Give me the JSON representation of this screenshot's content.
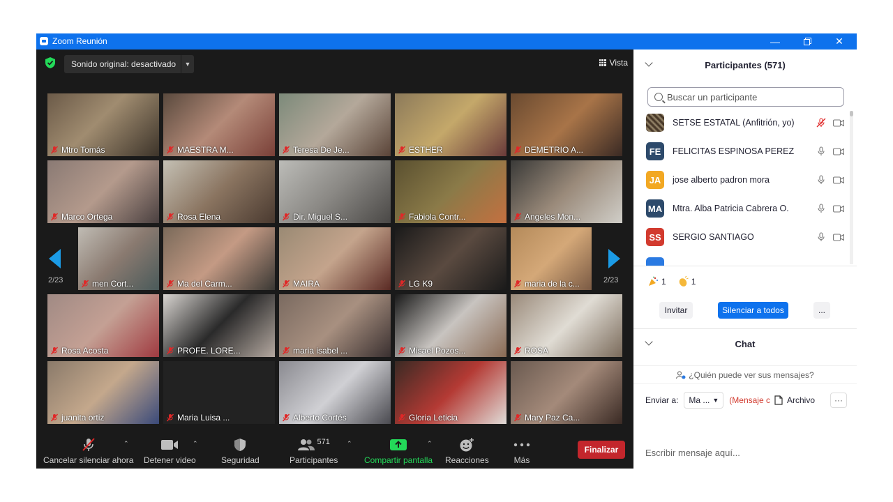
{
  "window": {
    "title": "Zoom Reunión"
  },
  "video": {
    "sound_button": "Sonido original: desactivado",
    "view_button": "Vista",
    "page_left": "2/23",
    "page_right": "2/23",
    "tiles": [
      {
        "name": "Mtro Tomás",
        "bg": "linear-gradient(135deg,#6b5a48,#a08c70 45%,#3d342a)"
      },
      {
        "name": "MAESTRA M...",
        "bg": "linear-gradient(135deg,#5a4a3e,#b48a78 50%,#7a4038)"
      },
      {
        "name": "Teresa De Je...",
        "bg": "linear-gradient(135deg,#7c8a7a,#b4a89a 50%,#5a4438)"
      },
      {
        "name": "ESTHER",
        "bg": "linear-gradient(135deg,#8c7a5a,#c4a86a 50%,#6a3a3a)"
      },
      {
        "name": "DEMETRIO A...",
        "bg": "linear-gradient(135deg,#6a4a30,#a87448 50%,#3a2a24)"
      },
      {
        "name": "Marco Ortega",
        "bg": "linear-gradient(135deg,#8a7a74,#b49a8c 50%,#4a4040)"
      },
      {
        "name": "Rosa Elena",
        "bg": "linear-gradient(135deg,#c4c0b4,#8a7460 50%,#4a3a30)"
      },
      {
        "name": "Dir. Miguel S...",
        "bg": "linear-gradient(135deg,#bcbcb8,#8a8884 50%,#4a4846)"
      },
      {
        "name": "Fabiola Contr...",
        "bg": "linear-gradient(135deg,#5a5030,#8a7a48 50%,#c47040)"
      },
      {
        "name": "Angeles Mon...",
        "bg": "linear-gradient(135deg,#3a3a38,#9a8a7a 50%,#d0cec8)"
      },
      {
        "name": "men Cort...",
        "bg": "linear-gradient(135deg,#c0bcb4,#8a7a70 50%,#4a5a5a)"
      },
      {
        "name": "Ma del Carm...",
        "bg": "linear-gradient(135deg,#7a6a5a,#c49a84 50%,#3a3834)"
      },
      {
        "name": "MAIRA",
        "bg": "linear-gradient(135deg,#9a8a74,#c4a48c 50%,#5a2a24)"
      },
      {
        "name": "LG K9",
        "bg": "linear-gradient(135deg,#1a1a1a,#5a4a40 50%,#1a1a1a)"
      },
      {
        "name": "maria de la c...",
        "bg": "linear-gradient(135deg,#b48a5a,#d4a878 50%,#7a5a44)"
      },
      {
        "name": "Rosa Acosta",
        "bg": "linear-gradient(135deg,#a08a84,#c4a094 50%,#a03a40)"
      },
      {
        "name": "PROFE. LORE...",
        "bg": "linear-gradient(135deg,#d8d4d0,#2a2a2a 50%,#b4a8a0)"
      },
      {
        "name": "maria isabel ...",
        "bg": "linear-gradient(135deg,#7a6a60,#a89080 50%,#3a3030)"
      },
      {
        "name": "Misael Pozos...",
        "bg": "linear-gradient(135deg,#1a1a1a,#c8c4c0 50%,#8a6a54)"
      },
      {
        "name": "ROSA",
        "bg": "linear-gradient(135deg,#9a8a7a,#e0dcd4 50%,#7a6a5a)"
      },
      {
        "name": "juanita ortiz",
        "bg": "linear-gradient(135deg,#8a7a6a,#c4a88c 50%,#3a4a7a)"
      },
      {
        "name": "Maria Luisa ...",
        "bg": "#222222"
      },
      {
        "name": "Alberto Cortés",
        "bg": "linear-gradient(135deg,#8a8a90,#d0d0d4 50%,#4a4a50)"
      },
      {
        "name": "Gloria Leticia",
        "bg": "linear-gradient(135deg,#3a2a24,#b43a34 50%,#e0dcd8)"
      },
      {
        "name": "Mary Paz Ca...",
        "bg": "linear-gradient(135deg,#6a5a50,#a48a7a 50%,#3a2a24)"
      }
    ]
  },
  "toolbar": {
    "mute": "Cancelar silenciar ahora",
    "video": "Detener video",
    "security": "Seguridad",
    "participants": "Participantes",
    "participants_count": "571",
    "share": "Compartir pantalla",
    "reactions": "Reacciones",
    "more": "Más",
    "end": "Finalizar"
  },
  "panel": {
    "participants_title": "Participantes (571)",
    "search_placeholder": "Buscar un participante",
    "participants": [
      {
        "name": "SETSE ESTATAL (Anfitrión, yo)",
        "initials": "",
        "color": "#5a4a3a",
        "muted": true
      },
      {
        "name": "FELICITAS ESPINOSA PEREZ",
        "initials": "FE",
        "color": "#2d4a6b",
        "muted": false
      },
      {
        "name": "jose alberto padron mora",
        "initials": "JA",
        "color": "#f2a823",
        "muted": false
      },
      {
        "name": "Mtra. Alba Patricia Cabrera O.",
        "initials": "MA",
        "color": "#2d4a6b",
        "muted": false
      },
      {
        "name": "SERGIO SANTIAGO",
        "initials": "SS",
        "color": "#d23a2e",
        "muted": false
      }
    ],
    "reaction_party_count": "1",
    "reaction_clap_count": "1",
    "invite_button": "Invitar",
    "mute_all_button": "Silenciar a todos",
    "more_button": "...",
    "chat_title": "Chat",
    "chat_who": "¿Quién puede ver sus mensajes?",
    "send_to_label": "Enviar a:",
    "send_to_value": "Ma ...",
    "send_note": "(Mensaje c",
    "file_label": "Archivo",
    "compose_placeholder": "Escribir mensaje aquí..."
  }
}
